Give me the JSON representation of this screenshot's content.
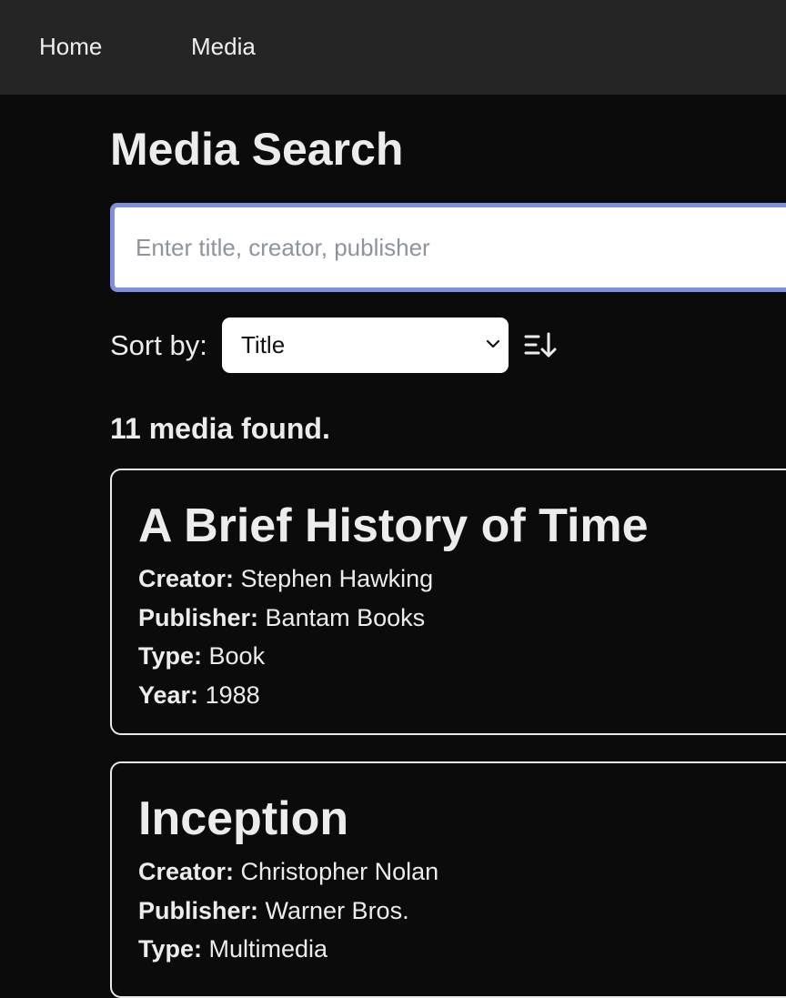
{
  "nav": {
    "items": [
      {
        "label": "Home"
      },
      {
        "label": "Media"
      }
    ]
  },
  "page": {
    "title": "Media Search"
  },
  "search": {
    "placeholder": "Enter title, creator, publisher",
    "value": ""
  },
  "sort": {
    "label": "Sort by:",
    "selected": "Title",
    "order_icon": "sort-ascending-icon"
  },
  "results": {
    "count_text": "11 media found.",
    "field_labels": {
      "creator": "Creator:",
      "publisher": "Publisher:",
      "type": "Type:",
      "year": "Year:"
    },
    "items": [
      {
        "title": "A Brief History of Time",
        "creator": "Stephen Hawking",
        "publisher": "Bantam Books",
        "type": "Book",
        "year": "1988"
      },
      {
        "title": "Inception",
        "creator": "Christopher Nolan",
        "publisher": "Warner Bros.",
        "type": "Multimedia"
      }
    ]
  },
  "colors": {
    "nav_background": "#252525",
    "page_background": "#0b0b0b",
    "search_border": "#7f8fde"
  }
}
